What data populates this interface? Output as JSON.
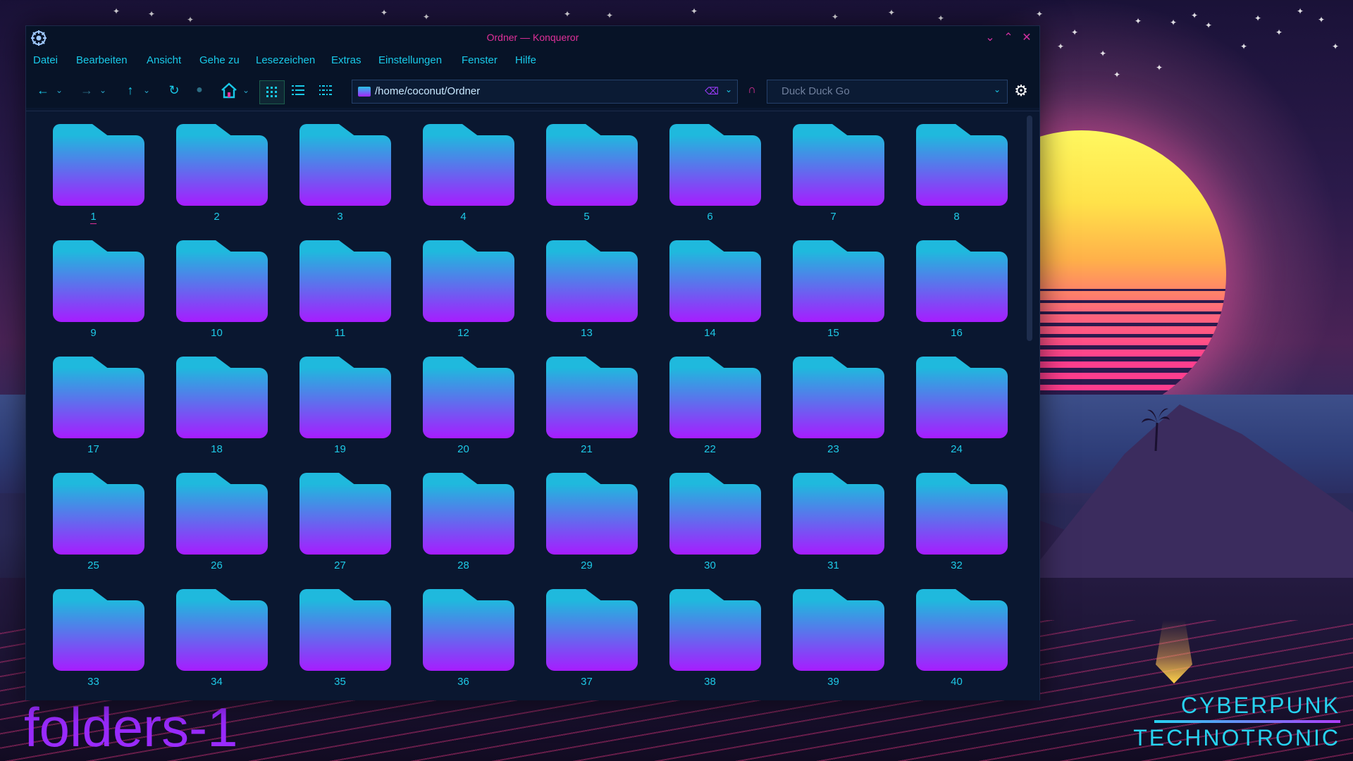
{
  "window": {
    "title": "Ordner — Konqueror",
    "controls": [
      "minimize",
      "maximize",
      "close"
    ]
  },
  "menu": [
    "Datei",
    "Bearbeiten",
    "Ansicht",
    "Gehe zu",
    "Lesezeichen",
    "Extras",
    "Einstellungen",
    "Fenster",
    "Hilfe"
  ],
  "toolbar": {
    "url": "/home/coconut/Ordner",
    "search_placeholder": "Duck Duck Go",
    "active_view": "icon-view"
  },
  "folders": [
    "1",
    "2",
    "3",
    "4",
    "5",
    "6",
    "7",
    "8",
    "9",
    "10",
    "11",
    "12",
    "13",
    "14",
    "15",
    "16",
    "17",
    "18",
    "19",
    "20",
    "21",
    "22",
    "23",
    "24",
    "25",
    "26",
    "27",
    "28",
    "29",
    "30",
    "31",
    "32",
    "33",
    "34",
    "35",
    "36",
    "37",
    "38",
    "39",
    "40"
  ],
  "wallpaper": {
    "brand_line1": "CYBERPUNK",
    "brand_line2": "TECHNOTRONIC"
  },
  "caption": "folders-1",
  "colors": {
    "accent_cyan": "#19c9e8",
    "accent_magenta": "#e0309a",
    "window_bg": "#0a1730",
    "folder_top": "#1fb9dd",
    "folder_bottom": "#a71cff"
  }
}
